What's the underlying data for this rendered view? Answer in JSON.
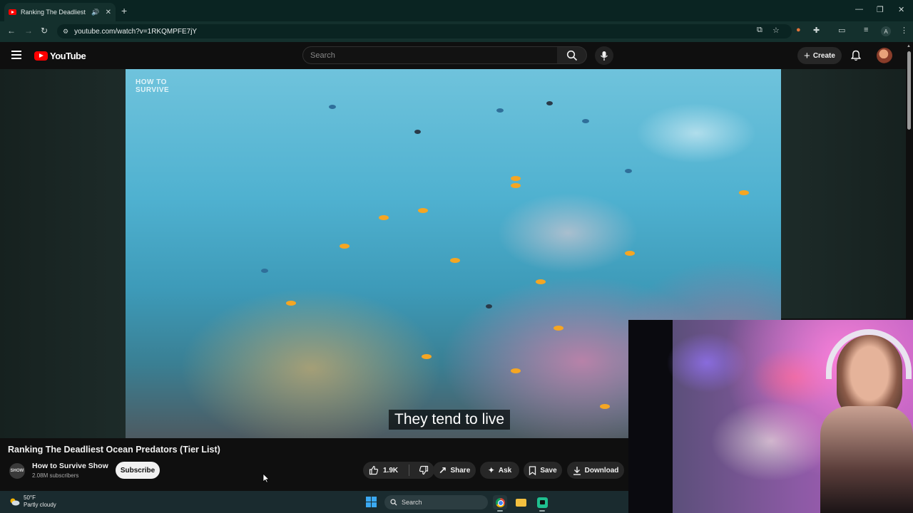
{
  "browser": {
    "tab_title": "Ranking The Deadliest Ocean Predators (Tier List) - YouTube",
    "new_tab_icon": "plus-icon",
    "url": "youtube.com/watch?v=1RKQMPFE7jY",
    "window_controls": [
      "minimize",
      "restore",
      "close"
    ]
  },
  "youtube": {
    "logo_text": "YouTube",
    "search_placeholder": "Search",
    "create_label": "Create",
    "brand_color": "#ff0000"
  },
  "video": {
    "watermark": "HOW TO SURVIVE",
    "caption": "They tend to live",
    "title": "Ranking The Deadliest Ocean Predators (Tier List)"
  },
  "channel": {
    "avatar_text": "SHOW",
    "name": "How to Survive Show",
    "subscribers": "2.08M subscribers",
    "subscribe_label": "Subscribe"
  },
  "actions": {
    "likes": "1.9K",
    "share": "Share",
    "ask": "Ask",
    "save": "Save",
    "download": "Download"
  },
  "taskbar": {
    "temperature": "50°F",
    "condition": "Partly cloudy",
    "search_label": "Search"
  },
  "profile_letter": "A"
}
